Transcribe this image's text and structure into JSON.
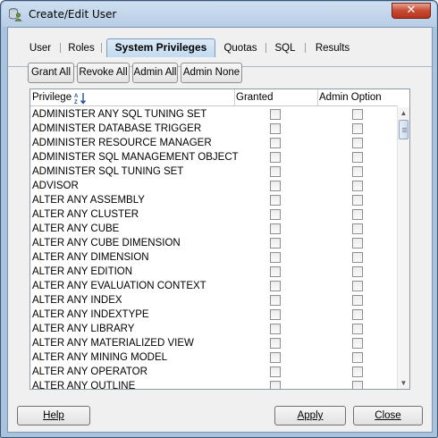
{
  "window": {
    "title": "Create/Edit User",
    "close_glyph": "✕"
  },
  "tabs": [
    {
      "label": "User"
    },
    {
      "label": "Roles"
    },
    {
      "label": "System Privileges",
      "active": true
    },
    {
      "label": "Quotas"
    },
    {
      "label": "SQL"
    },
    {
      "label": "Results"
    }
  ],
  "toolbar": {
    "grant_all": "Grant All",
    "revoke_all": "Revoke All",
    "admin_all": "Admin All",
    "admin_none": "Admin None"
  },
  "table": {
    "columns": [
      "Privilege",
      "Granted",
      "Admin Option"
    ],
    "sort_icon": "sort-az-icon",
    "rows": [
      {
        "privilege": "ADMINISTER ANY SQL TUNING SET",
        "granted": false,
        "admin": false
      },
      {
        "privilege": "ADMINISTER DATABASE TRIGGER",
        "granted": false,
        "admin": false
      },
      {
        "privilege": "ADMINISTER RESOURCE MANAGER",
        "granted": false,
        "admin": false
      },
      {
        "privilege": "ADMINISTER SQL MANAGEMENT OBJECT",
        "granted": false,
        "admin": false
      },
      {
        "privilege": "ADMINISTER SQL TUNING SET",
        "granted": false,
        "admin": false
      },
      {
        "privilege": "ADVISOR",
        "granted": false,
        "admin": false
      },
      {
        "privilege": "ALTER ANY ASSEMBLY",
        "granted": false,
        "admin": false
      },
      {
        "privilege": "ALTER ANY CLUSTER",
        "granted": false,
        "admin": false
      },
      {
        "privilege": "ALTER ANY CUBE",
        "granted": false,
        "admin": false
      },
      {
        "privilege": "ALTER ANY CUBE DIMENSION",
        "granted": false,
        "admin": false
      },
      {
        "privilege": "ALTER ANY DIMENSION",
        "granted": false,
        "admin": false
      },
      {
        "privilege": "ALTER ANY EDITION",
        "granted": false,
        "admin": false
      },
      {
        "privilege": "ALTER ANY EVALUATION CONTEXT",
        "granted": false,
        "admin": false
      },
      {
        "privilege": "ALTER ANY INDEX",
        "granted": false,
        "admin": false
      },
      {
        "privilege": "ALTER ANY INDEXTYPE",
        "granted": false,
        "admin": false
      },
      {
        "privilege": "ALTER ANY LIBRARY",
        "granted": false,
        "admin": false
      },
      {
        "privilege": "ALTER ANY MATERIALIZED VIEW",
        "granted": false,
        "admin": false
      },
      {
        "privilege": "ALTER ANY MINING MODEL",
        "granted": false,
        "admin": false
      },
      {
        "privilege": "ALTER ANY OPERATOR",
        "granted": false,
        "admin": false
      },
      {
        "privilege": "ALTER ANY OUTLINE",
        "granted": false,
        "admin": false
      }
    ]
  },
  "footer": {
    "help": "Help",
    "apply": "Apply",
    "close": "Close"
  },
  "colors": {
    "frame": "#a9c2dd",
    "active_tab": "#c3daf0",
    "close_button": "#c74a33"
  }
}
